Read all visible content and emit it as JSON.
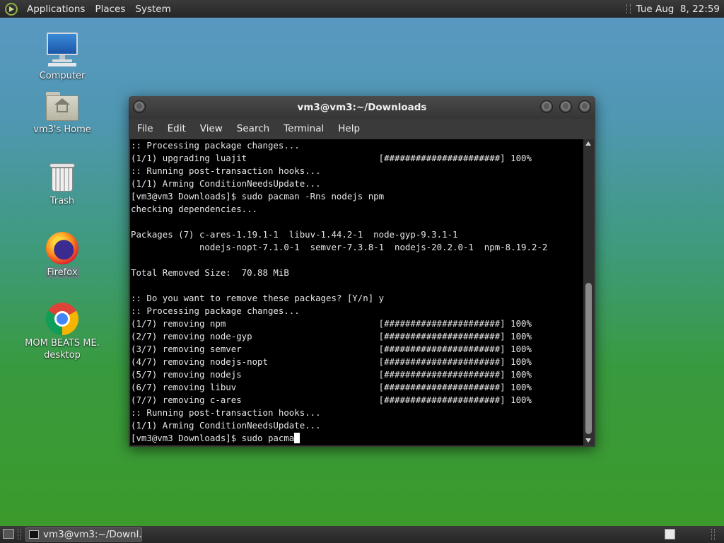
{
  "top_panel": {
    "menus": [
      "Applications",
      "Places",
      "System"
    ],
    "clock": "Tue Aug  8, 22:59"
  },
  "desktop_icons": [
    {
      "label": "Computer",
      "icon": "computer-icon"
    },
    {
      "label": "vm3's Home",
      "icon": "home-folder-icon"
    },
    {
      "label": "Trash",
      "icon": "trash-icon"
    },
    {
      "label": "Firefox",
      "icon": "firefox-icon"
    },
    {
      "label": "MOM BEATS ME.\ndesktop",
      "icon": "chrome-icon"
    }
  ],
  "terminal": {
    "title": "vm3@vm3:~/Downloads",
    "menu": [
      "File",
      "Edit",
      "View",
      "Search",
      "Terminal",
      "Help"
    ],
    "lines": [
      ":: Processing package changes...",
      "(1/1) upgrading luajit                         [######################] 100%",
      ":: Running post-transaction hooks...",
      "(1/1) Arming ConditionNeedsUpdate...",
      "[vm3@vm3 Downloads]$ sudo pacman -Rns nodejs npm",
      "checking dependencies...",
      "",
      "Packages (7) c-ares-1.19.1-1  libuv-1.44.2-1  node-gyp-9.3.1-1",
      "             nodejs-nopt-7.1.0-1  semver-7.3.8-1  nodejs-20.2.0-1  npm-8.19.2-2",
      "",
      "Total Removed Size:  70.88 MiB",
      "",
      ":: Do you want to remove these packages? [Y/n] y",
      ":: Processing package changes...",
      "(1/7) removing npm                             [######################] 100%",
      "(2/7) removing node-gyp                        [######################] 100%",
      "(3/7) removing semver                          [######################] 100%",
      "(4/7) removing nodejs-nopt                     [######################] 100%",
      "(5/7) removing nodejs                          [######################] 100%",
      "(6/7) removing libuv                           [######################] 100%",
      "(7/7) removing c-ares                          [######################] 100%",
      ":: Running post-transaction hooks...",
      "(1/1) Arming ConditionNeedsUpdate..."
    ],
    "prompt": "[vm3@vm3 Downloads]$ sudo pacma"
  },
  "taskbar": {
    "task_label": "vm3@vm3:~/Downl..."
  }
}
